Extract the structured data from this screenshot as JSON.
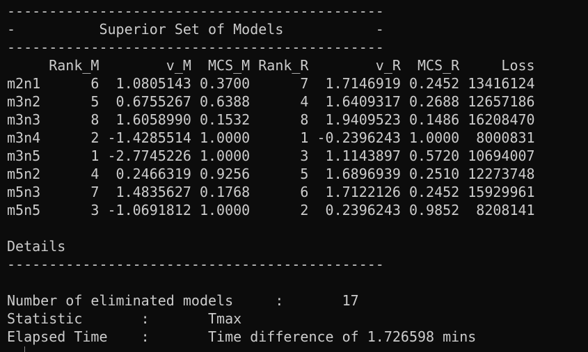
{
  "terminal": {
    "lines": [
      "---------------------------------------------",
      "-          Superior Set of Models           -",
      "---------------------------------------------",
      "     Rank_M        v_M  MCS_M Rank_R        v_R  MCS_R     Loss",
      "m2n1      6  1.0805143 0.3700      7  1.7146919 0.2452 13416124",
      "m3n2      5  0.6755267 0.6388      4  1.6409317 0.2688 12657186",
      "m3n3      8  1.6058990 0.1532      8  1.9409523 0.1486 16208470",
      "m3n4      2 -1.4285514 1.0000      1 -0.2396243 1.0000  8000831",
      "m3n5      1 -2.7745226 1.0000      3  1.1143897 0.5720 10694007",
      "m5n2      4  0.2466319 0.9256      5  1.6896939 0.2510 12273748",
      "m5n3      7  1.4835627 0.1768      6  1.7122126 0.2452 15929961",
      "m5n5      3 -1.0691812 1.0000      2  0.2396243 0.9852  8208141",
      "",
      "Details",
      "---------------------------------------------",
      "",
      "Number of eliminated models     :       17",
      "Statistic       :       Tmax",
      "Elapsed Time    :       Time difference of 1.726598 mins"
    ]
  }
}
